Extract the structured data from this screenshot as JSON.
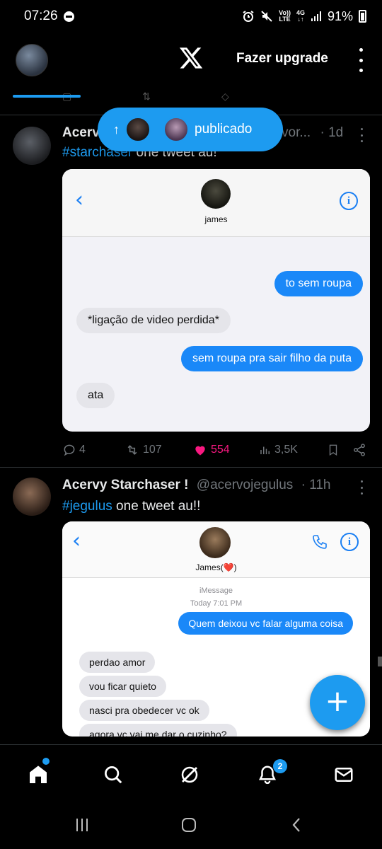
{
  "status_bar": {
    "time": "07:26",
    "network_top": "Vo))",
    "network_bottom": "LTE",
    "data_top": "4G",
    "data_bottom": "↓↑",
    "battery": "91%"
  },
  "header": {
    "upgrade_label": "Fazer upgrade"
  },
  "publicado_pill": {
    "arrow": "↑",
    "label": "publicado"
  },
  "tweets": [
    {
      "name": "Acerv",
      "handle_fragment": "vor...",
      "time": "· 1d",
      "hashtag": "#starchaser",
      "text": " one tweet au!",
      "chat": {
        "contact": "james",
        "messages": [
          {
            "dir": "out",
            "text": "to sem roupa"
          },
          {
            "dir": "in",
            "text": "*ligação de video perdida*"
          },
          {
            "dir": "out",
            "text": "sem roupa pra sair filho da puta"
          },
          {
            "dir": "in",
            "text": "ata"
          }
        ]
      },
      "actions": {
        "replies": "4",
        "reposts": "107",
        "likes": "554",
        "views": "3,5K"
      }
    },
    {
      "name": "Acervy Starchaser !",
      "handle": "@acervojegulus",
      "time": "· 11h",
      "hashtag": "#jegulus",
      "text": " one tweet au!!",
      "chat": {
        "contact": "James(❤️)",
        "service": "iMessage",
        "timestamp": "Today 7:01 PM",
        "messages": [
          {
            "dir": "out",
            "text": "Quem deixou vc falar alguma coisa"
          },
          {
            "dir": "in",
            "text": "perdao amor"
          },
          {
            "dir": "in",
            "text": "vou ficar quieto"
          },
          {
            "dir": "in",
            "text": "nasci pra obedecer vc ok"
          },
          {
            "dir": "in",
            "text": "agora vc vai me dar o cuzinho?"
          }
        ]
      }
    }
  ],
  "fab": {
    "label": "+"
  },
  "bottom_nav": {
    "notifications_badge": "2"
  },
  "colors": {
    "accent": "#1d9bf0",
    "like": "#f91880",
    "imessage_blue": "#1a88f8"
  }
}
